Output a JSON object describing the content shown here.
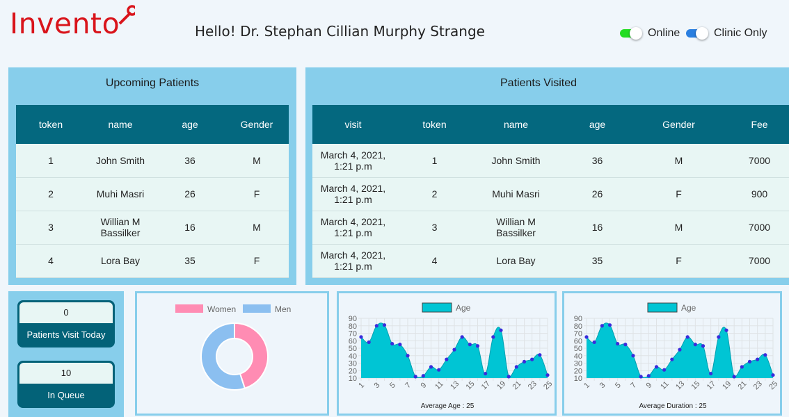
{
  "header": {
    "logo_text": "Invento",
    "greeting": "Hello! Dr. Stephan Cillian Murphy Strange",
    "toggles": [
      {
        "label": "Online",
        "color": "#22dd22",
        "on": true
      },
      {
        "label": "Clinic Only",
        "color": "#2a7fe0",
        "on": true
      }
    ]
  },
  "upcoming": {
    "title": "Upcoming Patients",
    "columns": [
      "token",
      "name",
      "age",
      "Gender"
    ],
    "rows": [
      [
        "1",
        "John Smith",
        "36",
        "M"
      ],
      [
        "2",
        "Muhi Masri",
        "26",
        "F"
      ],
      [
        "3",
        "Willian M Bassilker",
        "16",
        "M"
      ],
      [
        "4",
        "Lora Bay",
        "35",
        "F"
      ]
    ]
  },
  "visited": {
    "title": "Patients Visited",
    "columns": [
      "visit",
      "token",
      "name",
      "age",
      "Gender",
      "Fee"
    ],
    "rows": [
      [
        "March 4, 2021, 1:21 p.m",
        "1",
        "John Smith",
        "36",
        "M",
        "7000"
      ],
      [
        "March 4, 2021, 1:21 p.m",
        "2",
        "Muhi Masri",
        "26",
        "F",
        "900"
      ],
      [
        "March 4, 2021, 1:21 p.m",
        "3",
        "Willian M Bassilker",
        "16",
        "M",
        "7000"
      ],
      [
        "March 4, 2021, 1:21 p.m",
        "4",
        "Lora Bay",
        "35",
        "F",
        "7000"
      ]
    ]
  },
  "stats": {
    "visits_today": {
      "value": "0",
      "label": "Patients Visit Today"
    },
    "in_queue": {
      "value": "10",
      "label": "In Queue"
    }
  },
  "chart_data": [
    {
      "type": "pie",
      "categories": [
        "Women",
        "Men"
      ],
      "values": [
        45,
        55
      ],
      "colors": [
        "#ff8cb3",
        "#8bbff0"
      ],
      "legend": "top"
    },
    {
      "type": "area",
      "series": [
        {
          "name": "Age",
          "values": [
            65,
            58,
            80,
            81,
            56,
            55,
            40,
            12,
            13,
            25,
            21,
            35,
            48,
            65,
            55,
            53,
            16,
            65,
            74,
            12,
            25,
            32,
            35,
            41,
            14
          ]
        }
      ],
      "x": [
        1,
        2,
        3,
        4,
        5,
        6,
        7,
        8,
        9,
        10,
        11,
        12,
        13,
        14,
        15,
        16,
        17,
        18,
        19,
        20,
        21,
        22,
        23,
        24,
        25
      ],
      "xticks": [
        1,
        3,
        5,
        7,
        9,
        11,
        13,
        15,
        17,
        19,
        21,
        23,
        25
      ],
      "yticks": [
        10,
        20,
        30,
        40,
        50,
        60,
        70,
        80,
        90
      ],
      "ylim": [
        10,
        90
      ],
      "xlabel": "Average Age : 25",
      "color": "#00c5d4",
      "grid": true,
      "legend": "top"
    },
    {
      "type": "area",
      "series": [
        {
          "name": "Age",
          "values": [
            65,
            58,
            80,
            81,
            56,
            55,
            40,
            12,
            13,
            25,
            21,
            35,
            48,
            65,
            55,
            53,
            16,
            65,
            74,
            12,
            25,
            32,
            35,
            41,
            14
          ]
        }
      ],
      "x": [
        1,
        2,
        3,
        4,
        5,
        6,
        7,
        8,
        9,
        10,
        11,
        12,
        13,
        14,
        15,
        16,
        17,
        18,
        19,
        20,
        21,
        22,
        23,
        24,
        25
      ],
      "xticks": [
        1,
        3,
        5,
        7,
        9,
        11,
        13,
        15,
        17,
        19,
        21,
        23,
        25
      ],
      "yticks": [
        10,
        20,
        30,
        40,
        50,
        60,
        70,
        80,
        90
      ],
      "ylim": [
        10,
        90
      ],
      "xlabel": "Average Duration : 25",
      "color": "#00c5d4",
      "grid": true,
      "legend": "top"
    }
  ]
}
